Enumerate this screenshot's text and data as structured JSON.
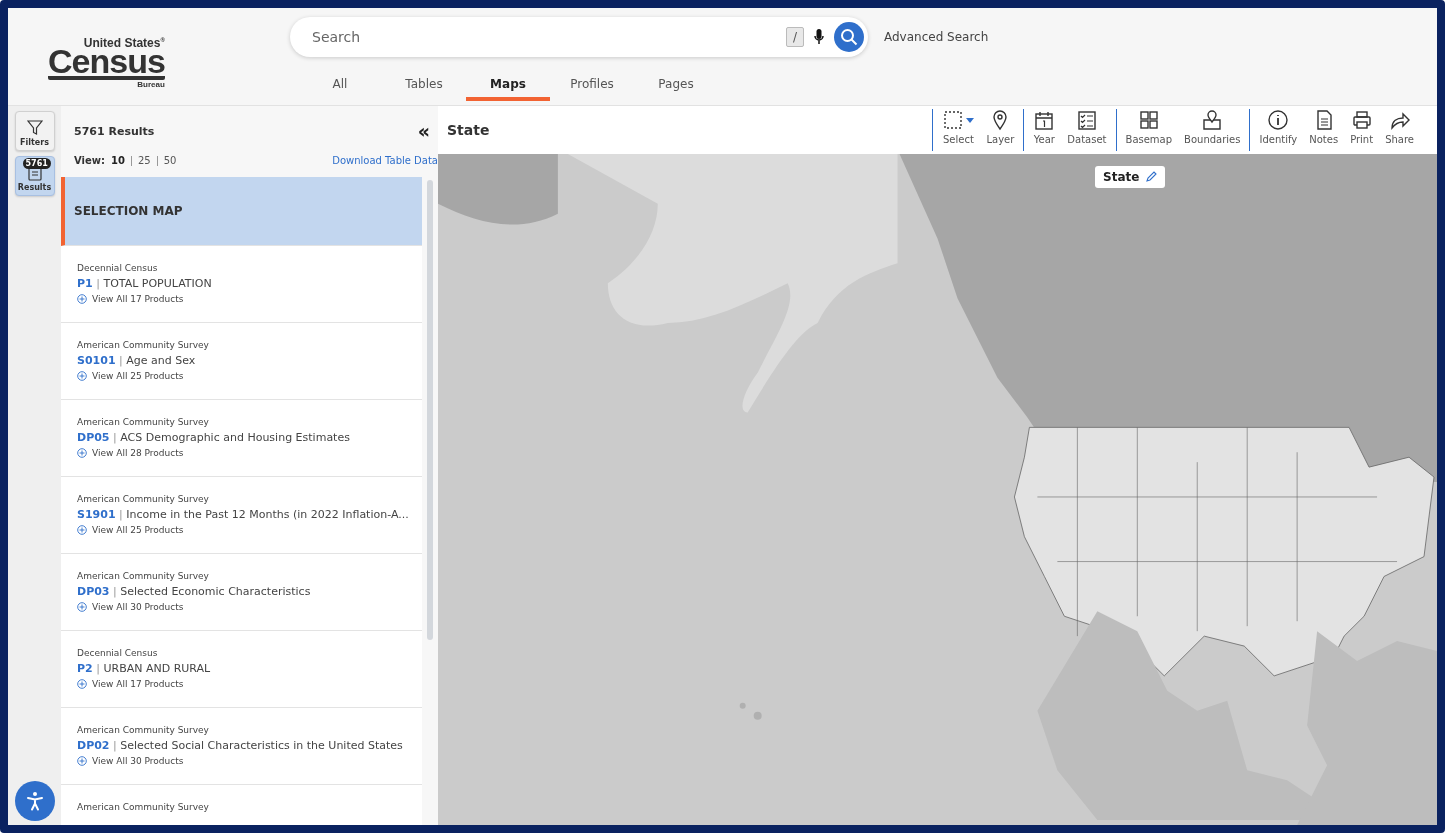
{
  "header": {
    "logo": {
      "top": "United States",
      "registered": "®",
      "main": "Census",
      "sub": "Bureau"
    },
    "search": {
      "placeholder": "Search",
      "shortcut": "/"
    },
    "advanced_search": "Advanced Search",
    "tabs": [
      {
        "label": "All",
        "selected": false
      },
      {
        "label": "Tables",
        "selected": false
      },
      {
        "label": "Maps",
        "selected": true
      },
      {
        "label": "Profiles",
        "selected": false
      },
      {
        "label": "Pages",
        "selected": false
      }
    ]
  },
  "rail": [
    {
      "label": "Filters",
      "selected": false
    },
    {
      "label": "Results",
      "selected": true,
      "badge": "5761"
    }
  ],
  "results": {
    "count": "5761 Results",
    "view_label": "View:",
    "view_options": [
      {
        "label": "10",
        "selected": true
      },
      {
        "label": "25",
        "selected": false
      },
      {
        "label": "50",
        "selected": false
      }
    ],
    "download": "Download Table Data",
    "collapse": "«",
    "selection_map": {
      "label": "SELECTION MAP",
      "selected": true
    },
    "items": [
      {
        "category": "Decennial Census",
        "code": "P1",
        "separator": "|",
        "title": "TOTAL POPULATION",
        "products": "View All 17 Products"
      },
      {
        "category": "American Community Survey",
        "code": "S0101",
        "separator": "|",
        "title": "Age and Sex",
        "products": "View All 25 Products"
      },
      {
        "category": "American Community Survey",
        "code": "DP05",
        "separator": "|",
        "title": "ACS Demographic and Housing Estimates",
        "products": "View All 28 Products"
      },
      {
        "category": "American Community Survey",
        "code": "S1901",
        "separator": "|",
        "title": "Income in the Past 12 Months (in 2022 Inflation-A...",
        "products": "View All 25 Products"
      },
      {
        "category": "American Community Survey",
        "code": "DP03",
        "separator": "|",
        "title": "Selected Economic Characteristics",
        "products": "View All 30 Products"
      },
      {
        "category": "Decennial Census",
        "code": "P2",
        "separator": "|",
        "title": "URBAN AND RURAL",
        "products": "View All 17 Products"
      },
      {
        "category": "American Community Survey",
        "code": "DP02",
        "separator": "|",
        "title": "Selected Social Characteristics in the United States",
        "products": "View All 30 Products"
      },
      {
        "category": "American Community Survey"
      }
    ]
  },
  "map": {
    "title": "State",
    "layer_label": "State",
    "tool_groups": [
      [
        {
          "label": "Select",
          "dropdown": true
        },
        {
          "label": "Layer"
        }
      ],
      [
        {
          "label": "Year"
        },
        {
          "label": "Dataset"
        }
      ],
      [
        {
          "label": "Basemap"
        },
        {
          "label": "Boundaries"
        }
      ],
      [
        {
          "label": "Identify"
        },
        {
          "label": "Notes"
        },
        {
          "label": "Print"
        },
        {
          "label": "Share"
        }
      ]
    ]
  }
}
